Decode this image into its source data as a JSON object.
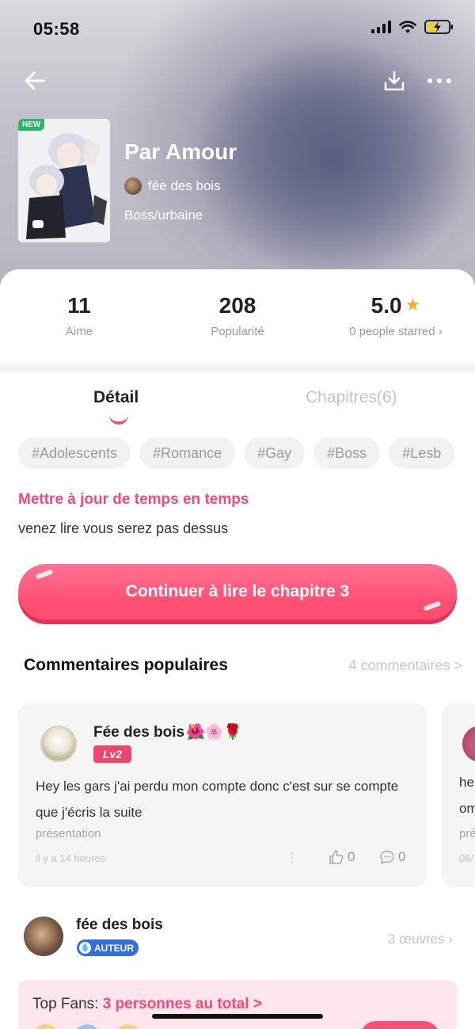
{
  "status_bar": {
    "time": "05:58"
  },
  "story": {
    "new_badge": "NEW",
    "title": "Par Amour",
    "author": "fée des bois",
    "genre": "Boss/urbaine"
  },
  "stats": [
    {
      "value": "11",
      "label": "Aime"
    },
    {
      "value": "208",
      "label": "Popularité"
    },
    {
      "value": "5.0",
      "label": "0 people starred ›"
    }
  ],
  "tabs": {
    "detail": "Détail",
    "chapters": "Chapitres(6)"
  },
  "tags": [
    "#Adolescents",
    "#Romance",
    "#Gay",
    "#Boss",
    "#Lesb"
  ],
  "update_notice": "Mettre à jour de temps en temps",
  "description": "venez lire vous serez pas dessus",
  "continue_button": "Continuer à lire le chapitre 3",
  "comments": {
    "title": "Commentaires populaires",
    "count_link": "4 commentaires >",
    "items": [
      {
        "username": "Fée des bois",
        "username_emoji": "🌺🌸🌹",
        "level": "Lv2",
        "text": "Hey les gars j'ai perdu mon compte donc c'est sur se compte que j'écris la suite",
        "category": "présentation",
        "time": "il y a 14 heures",
        "likes": "0",
        "replies": "0"
      }
    ],
    "peek": {
      "line1": "he",
      "line2": "om",
      "line3": "pré",
      "line4": "08/"
    }
  },
  "author_section": {
    "name": "fée des bois",
    "badge": "AUTEUR",
    "works": "3 œuvres"
  },
  "top_fans": {
    "label": "Top Fans: ",
    "total": "3 personnes au total >"
  },
  "colors": {
    "accent": "#f5497a",
    "button": "#ff4e72",
    "author_badge": "#2f6fe0",
    "star": "#f6b21b"
  }
}
